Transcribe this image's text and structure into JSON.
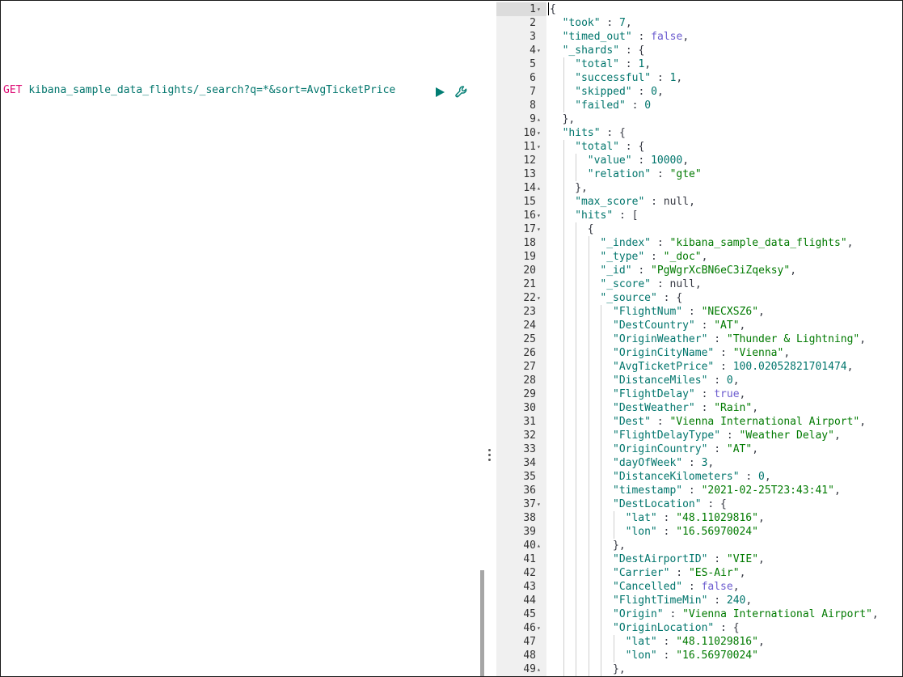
{
  "request": {
    "method": "GET",
    "url": "kibana_sample_data_flights/_search?q=*&sort=AvgTicketPrice"
  },
  "icons": {
    "run": "play-icon",
    "settings": "wrench-icon",
    "resize": "vertical-dots-icon"
  },
  "colors": {
    "method": "#dd0a73",
    "url": "#00756c",
    "key": "#00756c",
    "string": "#007a00",
    "boolean": "#6b5bcf",
    "run_button": "#017d73"
  },
  "response": {
    "lines": [
      {
        "n": "1",
        "fold": "down",
        "i": 0,
        "t": [
          [
            "p",
            "{"
          ]
        ]
      },
      {
        "n": "2",
        "i": 1,
        "t": [
          [
            "k",
            "\"took\""
          ],
          [
            "p",
            " : "
          ],
          [
            "n",
            "7"
          ],
          [
            "p",
            ","
          ]
        ]
      },
      {
        "n": "3",
        "i": 1,
        "t": [
          [
            "k",
            "\"timed_out\""
          ],
          [
            "p",
            " : "
          ],
          [
            "b",
            "false"
          ],
          [
            "p",
            ","
          ]
        ]
      },
      {
        "n": "4",
        "fold": "down",
        "i": 1,
        "t": [
          [
            "k",
            "\"_shards\""
          ],
          [
            "p",
            " : {"
          ]
        ]
      },
      {
        "n": "5",
        "i": 2,
        "t": [
          [
            "k",
            "\"total\""
          ],
          [
            "p",
            " : "
          ],
          [
            "n",
            "1"
          ],
          [
            "p",
            ","
          ]
        ]
      },
      {
        "n": "6",
        "i": 2,
        "t": [
          [
            "k",
            "\"successful\""
          ],
          [
            "p",
            " : "
          ],
          [
            "n",
            "1"
          ],
          [
            "p",
            ","
          ]
        ]
      },
      {
        "n": "7",
        "i": 2,
        "t": [
          [
            "k",
            "\"skipped\""
          ],
          [
            "p",
            " : "
          ],
          [
            "n",
            "0"
          ],
          [
            "p",
            ","
          ]
        ]
      },
      {
        "n": "8",
        "i": 2,
        "t": [
          [
            "k",
            "\"failed\""
          ],
          [
            "p",
            " : "
          ],
          [
            "n",
            "0"
          ]
        ]
      },
      {
        "n": "9",
        "fold": "up",
        "i": 1,
        "t": [
          [
            "p",
            "},"
          ]
        ]
      },
      {
        "n": "10",
        "fold": "down",
        "i": 1,
        "t": [
          [
            "k",
            "\"hits\""
          ],
          [
            "p",
            " : {"
          ]
        ]
      },
      {
        "n": "11",
        "fold": "down",
        "i": 2,
        "t": [
          [
            "k",
            "\"total\""
          ],
          [
            "p",
            " : {"
          ]
        ]
      },
      {
        "n": "12",
        "i": 3,
        "t": [
          [
            "k",
            "\"value\""
          ],
          [
            "p",
            " : "
          ],
          [
            "n",
            "10000"
          ],
          [
            "p",
            ","
          ]
        ]
      },
      {
        "n": "13",
        "i": 3,
        "t": [
          [
            "k",
            "\"relation\""
          ],
          [
            "p",
            " : "
          ],
          [
            "s",
            "\"gte\""
          ]
        ]
      },
      {
        "n": "14",
        "fold": "up",
        "i": 2,
        "t": [
          [
            "p",
            "},"
          ]
        ]
      },
      {
        "n": "15",
        "i": 2,
        "t": [
          [
            "k",
            "\"max_score\""
          ],
          [
            "p",
            " : "
          ],
          [
            "nl",
            "null"
          ],
          [
            "p",
            ","
          ]
        ]
      },
      {
        "n": "16",
        "fold": "down",
        "i": 2,
        "t": [
          [
            "k",
            "\"hits\""
          ],
          [
            "p",
            " : ["
          ]
        ]
      },
      {
        "n": "17",
        "fold": "down",
        "i": 3,
        "t": [
          [
            "p",
            "{"
          ]
        ]
      },
      {
        "n": "18",
        "i": 4,
        "t": [
          [
            "k",
            "\"_index\""
          ],
          [
            "p",
            " : "
          ],
          [
            "s",
            "\"kibana_sample_data_flights\""
          ],
          [
            "p",
            ","
          ]
        ]
      },
      {
        "n": "19",
        "i": 4,
        "t": [
          [
            "k",
            "\"_type\""
          ],
          [
            "p",
            " : "
          ],
          [
            "s",
            "\"_doc\""
          ],
          [
            "p",
            ","
          ]
        ]
      },
      {
        "n": "20",
        "i": 4,
        "t": [
          [
            "k",
            "\"_id\""
          ],
          [
            "p",
            " : "
          ],
          [
            "s",
            "\"PgWgrXcBN6eC3iZqeksy\""
          ],
          [
            "p",
            ","
          ]
        ]
      },
      {
        "n": "21",
        "i": 4,
        "t": [
          [
            "k",
            "\"_score\""
          ],
          [
            "p",
            " : "
          ],
          [
            "nl",
            "null"
          ],
          [
            "p",
            ","
          ]
        ]
      },
      {
        "n": "22",
        "fold": "down",
        "i": 4,
        "t": [
          [
            "k",
            "\"_source\""
          ],
          [
            "p",
            " : {"
          ]
        ]
      },
      {
        "n": "23",
        "i": 5,
        "t": [
          [
            "k",
            "\"FlightNum\""
          ],
          [
            "p",
            " : "
          ],
          [
            "s",
            "\"NECXSZ6\""
          ],
          [
            "p",
            ","
          ]
        ]
      },
      {
        "n": "24",
        "i": 5,
        "t": [
          [
            "k",
            "\"DestCountry\""
          ],
          [
            "p",
            " : "
          ],
          [
            "s",
            "\"AT\""
          ],
          [
            "p",
            ","
          ]
        ]
      },
      {
        "n": "25",
        "i": 5,
        "t": [
          [
            "k",
            "\"OriginWeather\""
          ],
          [
            "p",
            " : "
          ],
          [
            "s",
            "\"Thunder & Lightning\""
          ],
          [
            "p",
            ","
          ]
        ]
      },
      {
        "n": "26",
        "i": 5,
        "t": [
          [
            "k",
            "\"OriginCityName\""
          ],
          [
            "p",
            " : "
          ],
          [
            "s",
            "\"Vienna\""
          ],
          [
            "p",
            ","
          ]
        ]
      },
      {
        "n": "27",
        "i": 5,
        "t": [
          [
            "k",
            "\"AvgTicketPrice\""
          ],
          [
            "p",
            " : "
          ],
          [
            "n",
            "100.02052821701474"
          ],
          [
            "p",
            ","
          ]
        ]
      },
      {
        "n": "28",
        "i": 5,
        "t": [
          [
            "k",
            "\"DistanceMiles\""
          ],
          [
            "p",
            " : "
          ],
          [
            "n",
            "0"
          ],
          [
            "p",
            ","
          ]
        ]
      },
      {
        "n": "29",
        "i": 5,
        "t": [
          [
            "k",
            "\"FlightDelay\""
          ],
          [
            "p",
            " : "
          ],
          [
            "b",
            "true"
          ],
          [
            "p",
            ","
          ]
        ]
      },
      {
        "n": "30",
        "i": 5,
        "t": [
          [
            "k",
            "\"DestWeather\""
          ],
          [
            "p",
            " : "
          ],
          [
            "s",
            "\"Rain\""
          ],
          [
            "p",
            ","
          ]
        ]
      },
      {
        "n": "31",
        "i": 5,
        "t": [
          [
            "k",
            "\"Dest\""
          ],
          [
            "p",
            " : "
          ],
          [
            "s",
            "\"Vienna International Airport\""
          ],
          [
            "p",
            ","
          ]
        ]
      },
      {
        "n": "32",
        "i": 5,
        "t": [
          [
            "k",
            "\"FlightDelayType\""
          ],
          [
            "p",
            " : "
          ],
          [
            "s",
            "\"Weather Delay\""
          ],
          [
            "p",
            ","
          ]
        ]
      },
      {
        "n": "33",
        "i": 5,
        "t": [
          [
            "k",
            "\"OriginCountry\""
          ],
          [
            "p",
            " : "
          ],
          [
            "s",
            "\"AT\""
          ],
          [
            "p",
            ","
          ]
        ]
      },
      {
        "n": "34",
        "i": 5,
        "t": [
          [
            "k",
            "\"dayOfWeek\""
          ],
          [
            "p",
            " : "
          ],
          [
            "n",
            "3"
          ],
          [
            "p",
            ","
          ]
        ]
      },
      {
        "n": "35",
        "i": 5,
        "t": [
          [
            "k",
            "\"DistanceKilometers\""
          ],
          [
            "p",
            " : "
          ],
          [
            "n",
            "0"
          ],
          [
            "p",
            ","
          ]
        ]
      },
      {
        "n": "36",
        "i": 5,
        "t": [
          [
            "k",
            "\"timestamp\""
          ],
          [
            "p",
            " : "
          ],
          [
            "s",
            "\"2021-02-25T23:43:41\""
          ],
          [
            "p",
            ","
          ]
        ]
      },
      {
        "n": "37",
        "fold": "down",
        "i": 5,
        "t": [
          [
            "k",
            "\"DestLocation\""
          ],
          [
            "p",
            " : {"
          ]
        ]
      },
      {
        "n": "38",
        "i": 6,
        "t": [
          [
            "k",
            "\"lat\""
          ],
          [
            "p",
            " : "
          ],
          [
            "s",
            "\"48.11029816\""
          ],
          [
            "p",
            ","
          ]
        ]
      },
      {
        "n": "39",
        "i": 6,
        "t": [
          [
            "k",
            "\"lon\""
          ],
          [
            "p",
            " : "
          ],
          [
            "s",
            "\"16.56970024\""
          ]
        ]
      },
      {
        "n": "40",
        "fold": "up",
        "i": 5,
        "t": [
          [
            "p",
            "},"
          ]
        ]
      },
      {
        "n": "41",
        "i": 5,
        "t": [
          [
            "k",
            "\"DestAirportID\""
          ],
          [
            "p",
            " : "
          ],
          [
            "s",
            "\"VIE\""
          ],
          [
            "p",
            ","
          ]
        ]
      },
      {
        "n": "42",
        "i": 5,
        "t": [
          [
            "k",
            "\"Carrier\""
          ],
          [
            "p",
            " : "
          ],
          [
            "s",
            "\"ES-Air\""
          ],
          [
            "p",
            ","
          ]
        ]
      },
      {
        "n": "43",
        "i": 5,
        "t": [
          [
            "k",
            "\"Cancelled\""
          ],
          [
            "p",
            " : "
          ],
          [
            "b",
            "false"
          ],
          [
            "p",
            ","
          ]
        ]
      },
      {
        "n": "44",
        "i": 5,
        "t": [
          [
            "k",
            "\"FlightTimeMin\""
          ],
          [
            "p",
            " : "
          ],
          [
            "n",
            "240"
          ],
          [
            "p",
            ","
          ]
        ]
      },
      {
        "n": "45",
        "i": 5,
        "t": [
          [
            "k",
            "\"Origin\""
          ],
          [
            "p",
            " : "
          ],
          [
            "s",
            "\"Vienna International Airport\""
          ],
          [
            "p",
            ","
          ]
        ]
      },
      {
        "n": "46",
        "fold": "down",
        "i": 5,
        "t": [
          [
            "k",
            "\"OriginLocation\""
          ],
          [
            "p",
            " : {"
          ]
        ]
      },
      {
        "n": "47",
        "i": 6,
        "t": [
          [
            "k",
            "\"lat\""
          ],
          [
            "p",
            " : "
          ],
          [
            "s",
            "\"48.11029816\""
          ],
          [
            "p",
            ","
          ]
        ]
      },
      {
        "n": "48",
        "i": 6,
        "t": [
          [
            "k",
            "\"lon\""
          ],
          [
            "p",
            " : "
          ],
          [
            "s",
            "\"16.56970024\""
          ]
        ]
      },
      {
        "n": "49",
        "fold": "up",
        "i": 5,
        "t": [
          [
            "p",
            "},"
          ]
        ]
      }
    ]
  }
}
